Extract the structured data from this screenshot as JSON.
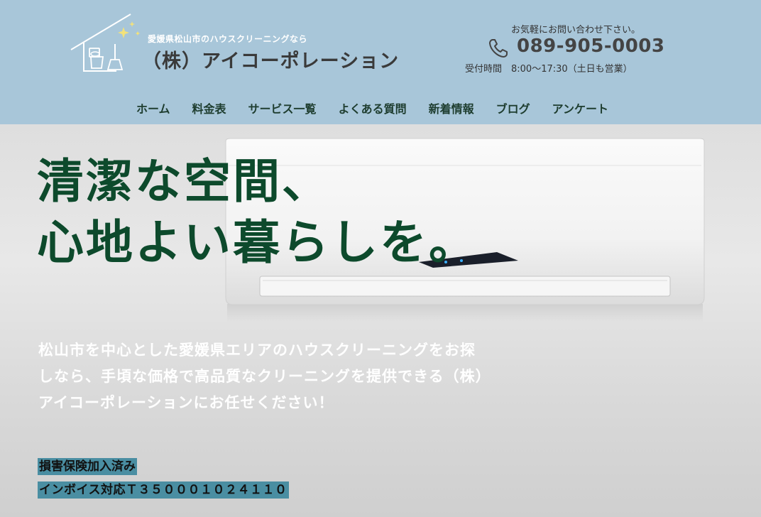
{
  "header": {
    "tagline": "愛媛県松山市のハウスクリーニングなら",
    "company_name": "（株）アイコーポレーション",
    "contact_caption": "お気軽にお問い合わせ下さい。",
    "phone": "089-905-0003",
    "hours": "受付時間　8:00～17:30（土日も営業）",
    "logo_icon": "house-cleaning-icon",
    "phone_icon": "phone-icon",
    "background_color": "#a8c6d9"
  },
  "nav": {
    "items": [
      {
        "label": "ホーム"
      },
      {
        "label": "料金表"
      },
      {
        "label": "サービス一覧"
      },
      {
        "label": "よくある質問"
      },
      {
        "label": "新着情報"
      },
      {
        "label": "ブログ"
      },
      {
        "label": "アンケート"
      }
    ]
  },
  "hero": {
    "headline_line1": "清潔な空間、",
    "headline_line2": "心地よい暮らしを。",
    "description": "松山市を中心とした愛媛県エリアのハウスクリーニングをお探しなら、手頃な価格で高品質なクリーニングを提供できる（株）アイコーポレーションにお任せください！",
    "badge_insurance": "損害保険加入済み",
    "badge_invoice": "インボイス対応Ｔ３５０００１０２４１１０",
    "headline_color": "#0d4a2c",
    "badge_color": "#4a8ea2"
  }
}
